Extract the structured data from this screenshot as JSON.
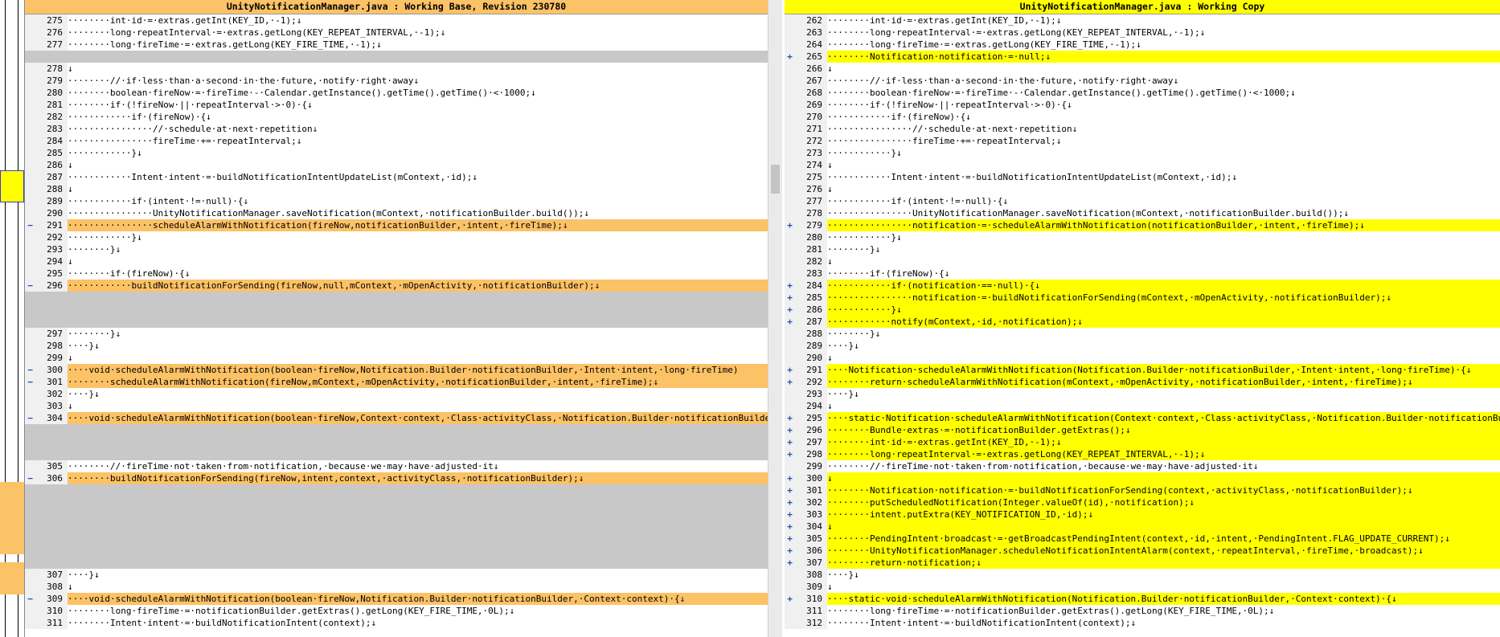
{
  "left": {
    "title": "UnityNotificationManager.java : Working Base, Revision 230780",
    "rows": [
      {
        "n": "275",
        "m": "",
        "t": "········int·id·=·extras.getInt(KEY_ID,·-1);↓"
      },
      {
        "n": "276",
        "m": "",
        "t": "········long·repeatInterval·=·extras.getLong(KEY_REPEAT_INTERVAL,·-1);↓"
      },
      {
        "n": "277",
        "m": "",
        "t": "········long·fireTime·=·extras.getLong(KEY_FIRE_TIME,·-1);↓"
      },
      {
        "n": "",
        "m": "",
        "t": "",
        "k": "filler"
      },
      {
        "n": "278",
        "m": "",
        "t": "↓"
      },
      {
        "n": "279",
        "m": "",
        "t": "········//·if·less·than·a·second·in·the·future,·notify·right·away↓"
      },
      {
        "n": "280",
        "m": "",
        "t": "········boolean·fireNow·=·fireTime·-·Calendar.getInstance().getTime().getTime()·<·1000;↓"
      },
      {
        "n": "281",
        "m": "",
        "t": "········if·(!fireNow·||·repeatInterval·>·0)·{↓"
      },
      {
        "n": "282",
        "m": "",
        "t": "············if·(fireNow)·{↓"
      },
      {
        "n": "283",
        "m": "",
        "t": "················//·schedule·at·next·repetition↓"
      },
      {
        "n": "284",
        "m": "",
        "t": "················fireTime·+=·repeatInterval;↓"
      },
      {
        "n": "285",
        "m": "",
        "t": "············}↓"
      },
      {
        "n": "286",
        "m": "",
        "t": "↓"
      },
      {
        "n": "287",
        "m": "",
        "t": "············Intent·intent·=·buildNotificationIntentUpdateList(mContext,·id);↓"
      },
      {
        "n": "288",
        "m": "",
        "t": "↓"
      },
      {
        "n": "289",
        "m": "",
        "t": "············if·(intent·!=·null)·{↓"
      },
      {
        "n": "290",
        "m": "",
        "t": "················UnityNotificationManager.saveNotification(mContext,·notificationBuilder.build());↓"
      },
      {
        "n": "291",
        "m": "−",
        "t": "················scheduleAlarmWithNotification(fireNow,notificationBuilder,·intent,·fireTime);↓",
        "k": "chg"
      },
      {
        "n": "292",
        "m": "",
        "t": "············}↓"
      },
      {
        "n": "293",
        "m": "",
        "t": "········}↓"
      },
      {
        "n": "294",
        "m": "",
        "t": "↓"
      },
      {
        "n": "295",
        "m": "",
        "t": "········if·(fireNow)·{↓"
      },
      {
        "n": "296",
        "m": "−",
        "t": "············buildNotificationForSending(fireNow,null,mContext,·mOpenActivity,·notificationBuilder);↓",
        "k": "chg"
      },
      {
        "n": "",
        "m": "",
        "t": "",
        "k": "filler"
      },
      {
        "n": "",
        "m": "",
        "t": "",
        "k": "filler"
      },
      {
        "n": "",
        "m": "",
        "t": "",
        "k": "filler"
      },
      {
        "n": "297",
        "m": "",
        "t": "········}↓"
      },
      {
        "n": "298",
        "m": "",
        "t": "····}↓"
      },
      {
        "n": "299",
        "m": "",
        "t": "↓"
      },
      {
        "n": "300",
        "m": "−",
        "t": "····void·scheduleAlarmWithNotification(boolean·fireNow,Notification.Builder·notificationBuilder,·Intent·intent,·long·fireTime)",
        "k": "chg"
      },
      {
        "n": "301",
        "m": "−",
        "t": "········scheduleAlarmWithNotification(fireNow,mContext,·mOpenActivity,·notificationBuilder,·intent,·fireTime);↓",
        "k": "chg"
      },
      {
        "n": "302",
        "m": "",
        "t": "····}↓"
      },
      {
        "n": "303",
        "m": "",
        "t": "↓"
      },
      {
        "n": "304",
        "m": "−",
        "t": "····void·scheduleAlarmWithNotification(boolean·fireNow,Context·context,·Class·activityClass,·Notification.Builder·notificationBuilder",
        "k": "chg"
      },
      {
        "n": "",
        "m": "",
        "t": "",
        "k": "filler"
      },
      {
        "n": "",
        "m": "",
        "t": "",
        "k": "filler"
      },
      {
        "n": "",
        "m": "",
        "t": "",
        "k": "filler"
      },
      {
        "n": "305",
        "m": "",
        "t": "········//·fireTime·not·taken·from·notification,·because·we·may·have·adjusted·it↓"
      },
      {
        "n": "306",
        "m": "−",
        "t": "········buildNotificationForSending(fireNow,intent,context,·activityClass,·notificationBuilder);↓",
        "k": "chg"
      },
      {
        "n": "",
        "m": "",
        "t": "",
        "k": "filler"
      },
      {
        "n": "",
        "m": "",
        "t": "",
        "k": "filler"
      },
      {
        "n": "",
        "m": "",
        "t": "",
        "k": "filler"
      },
      {
        "n": "",
        "m": "",
        "t": "",
        "k": "filler"
      },
      {
        "n": "",
        "m": "",
        "t": "",
        "k": "filler"
      },
      {
        "n": "",
        "m": "",
        "t": "",
        "k": "filler"
      },
      {
        "n": "",
        "m": "",
        "t": "",
        "k": "filler"
      },
      {
        "n": "307",
        "m": "",
        "t": "····}↓"
      },
      {
        "n": "308",
        "m": "",
        "t": "↓"
      },
      {
        "n": "309",
        "m": "−",
        "t": "····void·scheduleAlarmWithNotification(boolean·fireNow,Notification.Builder·notificationBuilder,·Context·context)·{↓",
        "k": "chg"
      },
      {
        "n": "310",
        "m": "",
        "t": "········long·fireTime·=·notificationBuilder.getExtras().getLong(KEY_FIRE_TIME,·0L);↓"
      },
      {
        "n": "311",
        "m": "",
        "t": "········Intent·intent·=·buildNotificationIntent(context);↓"
      }
    ]
  },
  "right": {
    "title": "UnityNotificationManager.java : Working Copy",
    "rows": [
      {
        "n": "262",
        "m": "",
        "t": "········int·id·=·extras.getInt(KEY_ID,·-1);↓"
      },
      {
        "n": "263",
        "m": "",
        "t": "········long·repeatInterval·=·extras.getLong(KEY_REPEAT_INTERVAL,·-1);↓"
      },
      {
        "n": "264",
        "m": "",
        "t": "········long·fireTime·=·extras.getLong(KEY_FIRE_TIME,·-1);↓"
      },
      {
        "n": "265",
        "m": "+",
        "t": "········Notification·notification·=·null;↓",
        "k": "chg"
      },
      {
        "n": "266",
        "m": "",
        "t": "↓"
      },
      {
        "n": "267",
        "m": "",
        "t": "········//·if·less·than·a·second·in·the·future,·notify·right·away↓"
      },
      {
        "n": "268",
        "m": "",
        "t": "········boolean·fireNow·=·fireTime·-·Calendar.getInstance().getTime().getTime()·<·1000;↓"
      },
      {
        "n": "269",
        "m": "",
        "t": "········if·(!fireNow·||·repeatInterval·>·0)·{↓"
      },
      {
        "n": "270",
        "m": "",
        "t": "············if·(fireNow)·{↓"
      },
      {
        "n": "271",
        "m": "",
        "t": "················//·schedule·at·next·repetition↓"
      },
      {
        "n": "272",
        "m": "",
        "t": "················fireTime·+=·repeatInterval;↓"
      },
      {
        "n": "273",
        "m": "",
        "t": "············}↓"
      },
      {
        "n": "274",
        "m": "",
        "t": "↓"
      },
      {
        "n": "275",
        "m": "",
        "t": "············Intent·intent·=·buildNotificationIntentUpdateList(mContext,·id);↓"
      },
      {
        "n": "276",
        "m": "",
        "t": "↓"
      },
      {
        "n": "277",
        "m": "",
        "t": "············if·(intent·!=·null)·{↓"
      },
      {
        "n": "278",
        "m": "",
        "t": "················UnityNotificationManager.saveNotification(mContext,·notificationBuilder.build());↓"
      },
      {
        "n": "279",
        "m": "+",
        "t": "················notification·=·scheduleAlarmWithNotification(notificationBuilder,·intent,·fireTime);↓",
        "k": "chg"
      },
      {
        "n": "280",
        "m": "",
        "t": "············}↓"
      },
      {
        "n": "281",
        "m": "",
        "t": "········}↓"
      },
      {
        "n": "282",
        "m": "",
        "t": "↓"
      },
      {
        "n": "283",
        "m": "",
        "t": "········if·(fireNow)·{↓"
      },
      {
        "n": "284",
        "m": "+",
        "t": "············if·(notification·==·null)·{↓",
        "k": "chg"
      },
      {
        "n": "285",
        "m": "+",
        "t": "················notification·=·buildNotificationForSending(mContext,·mOpenActivity,·notificationBuilder);↓",
        "k": "chg"
      },
      {
        "n": "286",
        "m": "+",
        "t": "············}↓",
        "k": "chg"
      },
      {
        "n": "287",
        "m": "+",
        "t": "············notify(mContext,·id,·notification);↓",
        "k": "chg"
      },
      {
        "n": "288",
        "m": "",
        "t": "········}↓"
      },
      {
        "n": "289",
        "m": "",
        "t": "····}↓"
      },
      {
        "n": "290",
        "m": "",
        "t": "↓"
      },
      {
        "n": "291",
        "m": "+",
        "t": "····Notification·scheduleAlarmWithNotification(Notification.Builder·notificationBuilder,·Intent·intent,·long·fireTime)·{↓",
        "k": "chg"
      },
      {
        "n": "292",
        "m": "+",
        "t": "········return·scheduleAlarmWithNotification(mContext,·mOpenActivity,·notificationBuilder,·intent,·fireTime);↓",
        "k": "chg"
      },
      {
        "n": "293",
        "m": "",
        "t": "····}↓"
      },
      {
        "n": "294",
        "m": "",
        "t": "↓"
      },
      {
        "n": "295",
        "m": "+",
        "t": "····static·Notification·scheduleAlarmWithNotification(Context·context,·Class·activityClass,·Notification.Builder·notificationBuilder",
        "k": "chg"
      },
      {
        "n": "296",
        "m": "+",
        "t": "········Bundle·extras·=·notificationBuilder.getExtras();↓",
        "k": "chg"
      },
      {
        "n": "297",
        "m": "+",
        "t": "········int·id·=·extras.getInt(KEY_ID,·-1);↓",
        "k": "chg"
      },
      {
        "n": "298",
        "m": "+",
        "t": "········long·repeatInterval·=·extras.getLong(KEY_REPEAT_INTERVAL,·-1);↓",
        "k": "chg"
      },
      {
        "n": "299",
        "m": "",
        "t": "········//·fireTime·not·taken·from·notification,·because·we·may·have·adjusted·it↓"
      },
      {
        "n": "300",
        "m": "+",
        "t": "↓",
        "k": "chg"
      },
      {
        "n": "301",
        "m": "+",
        "t": "········Notification·notification·=·buildNotificationForSending(context,·activityClass,·notificationBuilder);↓",
        "k": "chg"
      },
      {
        "n": "302",
        "m": "+",
        "t": "········putScheduledNotification(Integer.valueOf(id),·notification);↓",
        "k": "chg"
      },
      {
        "n": "303",
        "m": "+",
        "t": "········intent.putExtra(KEY_NOTIFICATION_ID,·id);↓",
        "k": "chg"
      },
      {
        "n": "304",
        "m": "+",
        "t": "↓",
        "k": "chg"
      },
      {
        "n": "305",
        "m": "+",
        "t": "········PendingIntent·broadcast·=·getBroadcastPendingIntent(context,·id,·intent,·PendingIntent.FLAG_UPDATE_CURRENT);↓",
        "k": "chg"
      },
      {
        "n": "306",
        "m": "+",
        "t": "········UnityNotificationManager.scheduleNotificationIntentAlarm(context,·repeatInterval,·fireTime,·broadcast);↓",
        "k": "chg"
      },
      {
        "n": "307",
        "m": "+",
        "t": "········return·notification;↓",
        "k": "chg"
      },
      {
        "n": "308",
        "m": "",
        "t": "····}↓"
      },
      {
        "n": "309",
        "m": "",
        "t": "↓"
      },
      {
        "n": "310",
        "m": "+",
        "t": "····static·void·scheduleAlarmWithNotification(Notification.Builder·notificationBuilder,·Context·context)·{↓",
        "k": "chg"
      },
      {
        "n": "311",
        "m": "",
        "t": "········long·fireTime·=·notificationBuilder.getExtras().getLong(KEY_FIRE_TIME,·0L);↓"
      },
      {
        "n": "312",
        "m": "",
        "t": "········Intent·intent·=·buildNotificationIntent(context);↓"
      }
    ]
  },
  "colors": {
    "left_header": "#fcc266",
    "right_header": "#ffff00",
    "left_changed": "#fcc266",
    "right_changed": "#ffff00",
    "removed_word": "#d05050",
    "filler": "#c8c8c8",
    "marker": "#2255aa"
  }
}
